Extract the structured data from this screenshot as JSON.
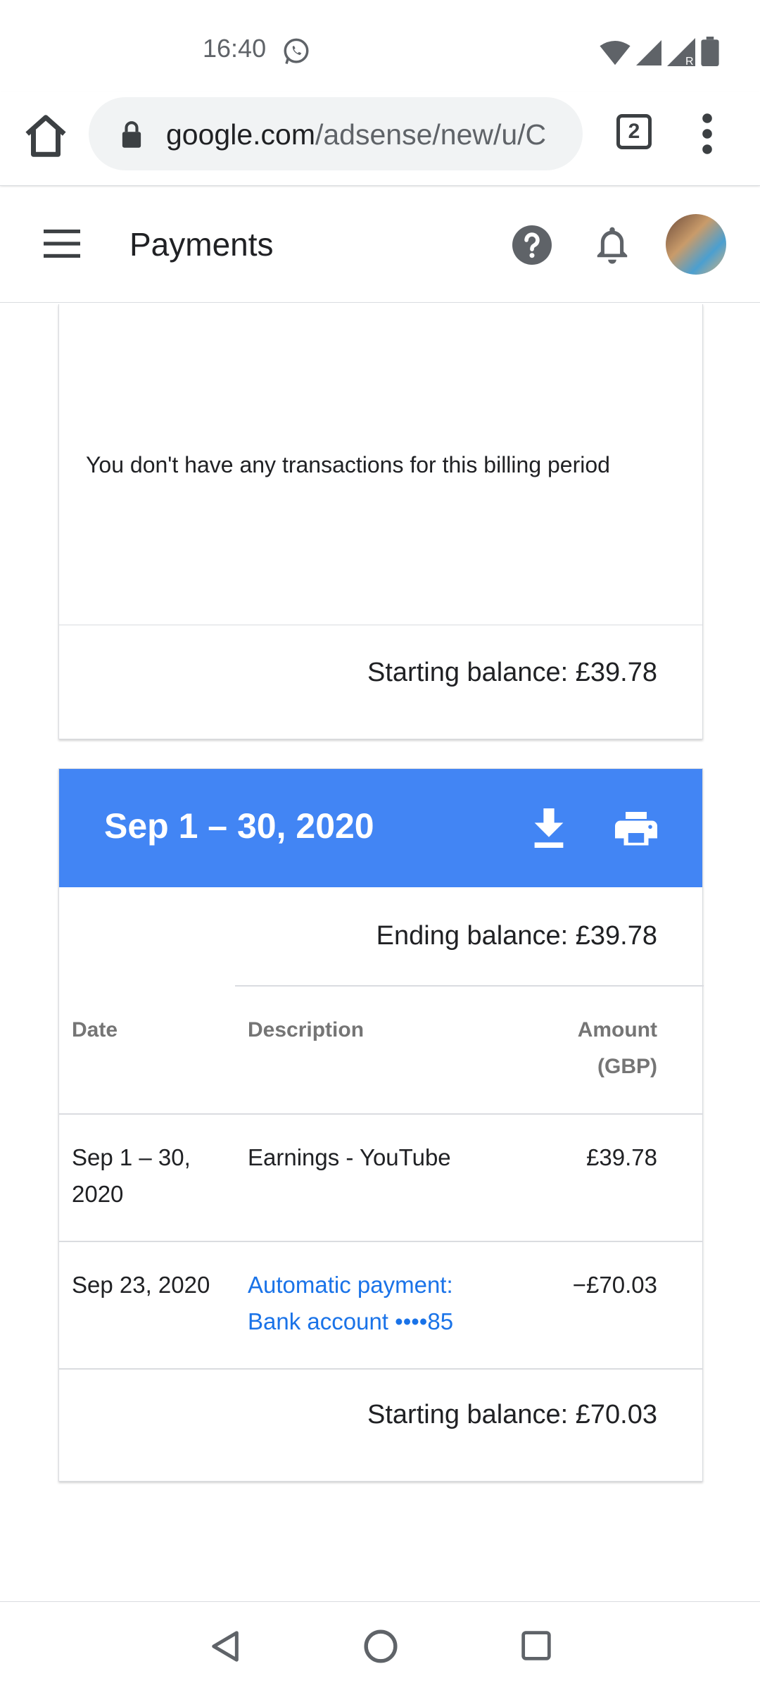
{
  "status_bar": {
    "time": "16:40",
    "icons": [
      "whatsapp-icon",
      "wifi-icon",
      "signal-icon",
      "signal-roaming-icon",
      "battery-icon"
    ],
    "roaming_badge": "R"
  },
  "browser": {
    "url_host": "google.com",
    "url_path": "/adsense/new/u/C",
    "tab_count": "2"
  },
  "header": {
    "title": "Payments"
  },
  "previous_period": {
    "empty_message": "You don't have any transactions for this billing period",
    "starting_balance": "Starting balance: £39.78"
  },
  "period": {
    "title": "Sep 1 – 30, 2020",
    "ending_balance": "Ending balance: £39.78",
    "columns": {
      "date": "Date",
      "description": "Description",
      "amount_line1": "Amount",
      "amount_line2": "(GBP)"
    },
    "rows": [
      {
        "date_line1": "Sep 1 – 30,",
        "date_line2": "2020",
        "description_line1": "Earnings - YouTube",
        "description_line2": "",
        "amount": "£39.78"
      },
      {
        "date_line1": "Sep 23, 2020",
        "date_line2": "",
        "description_line1": "Automatic payment:",
        "description_line2": "Bank account  ••••85",
        "amount": "−£70.03"
      }
    ],
    "starting_balance": "Starting balance: £70.03"
  },
  "colors": {
    "band_blue": "#4285f4",
    "link_blue": "#1a73e8"
  }
}
